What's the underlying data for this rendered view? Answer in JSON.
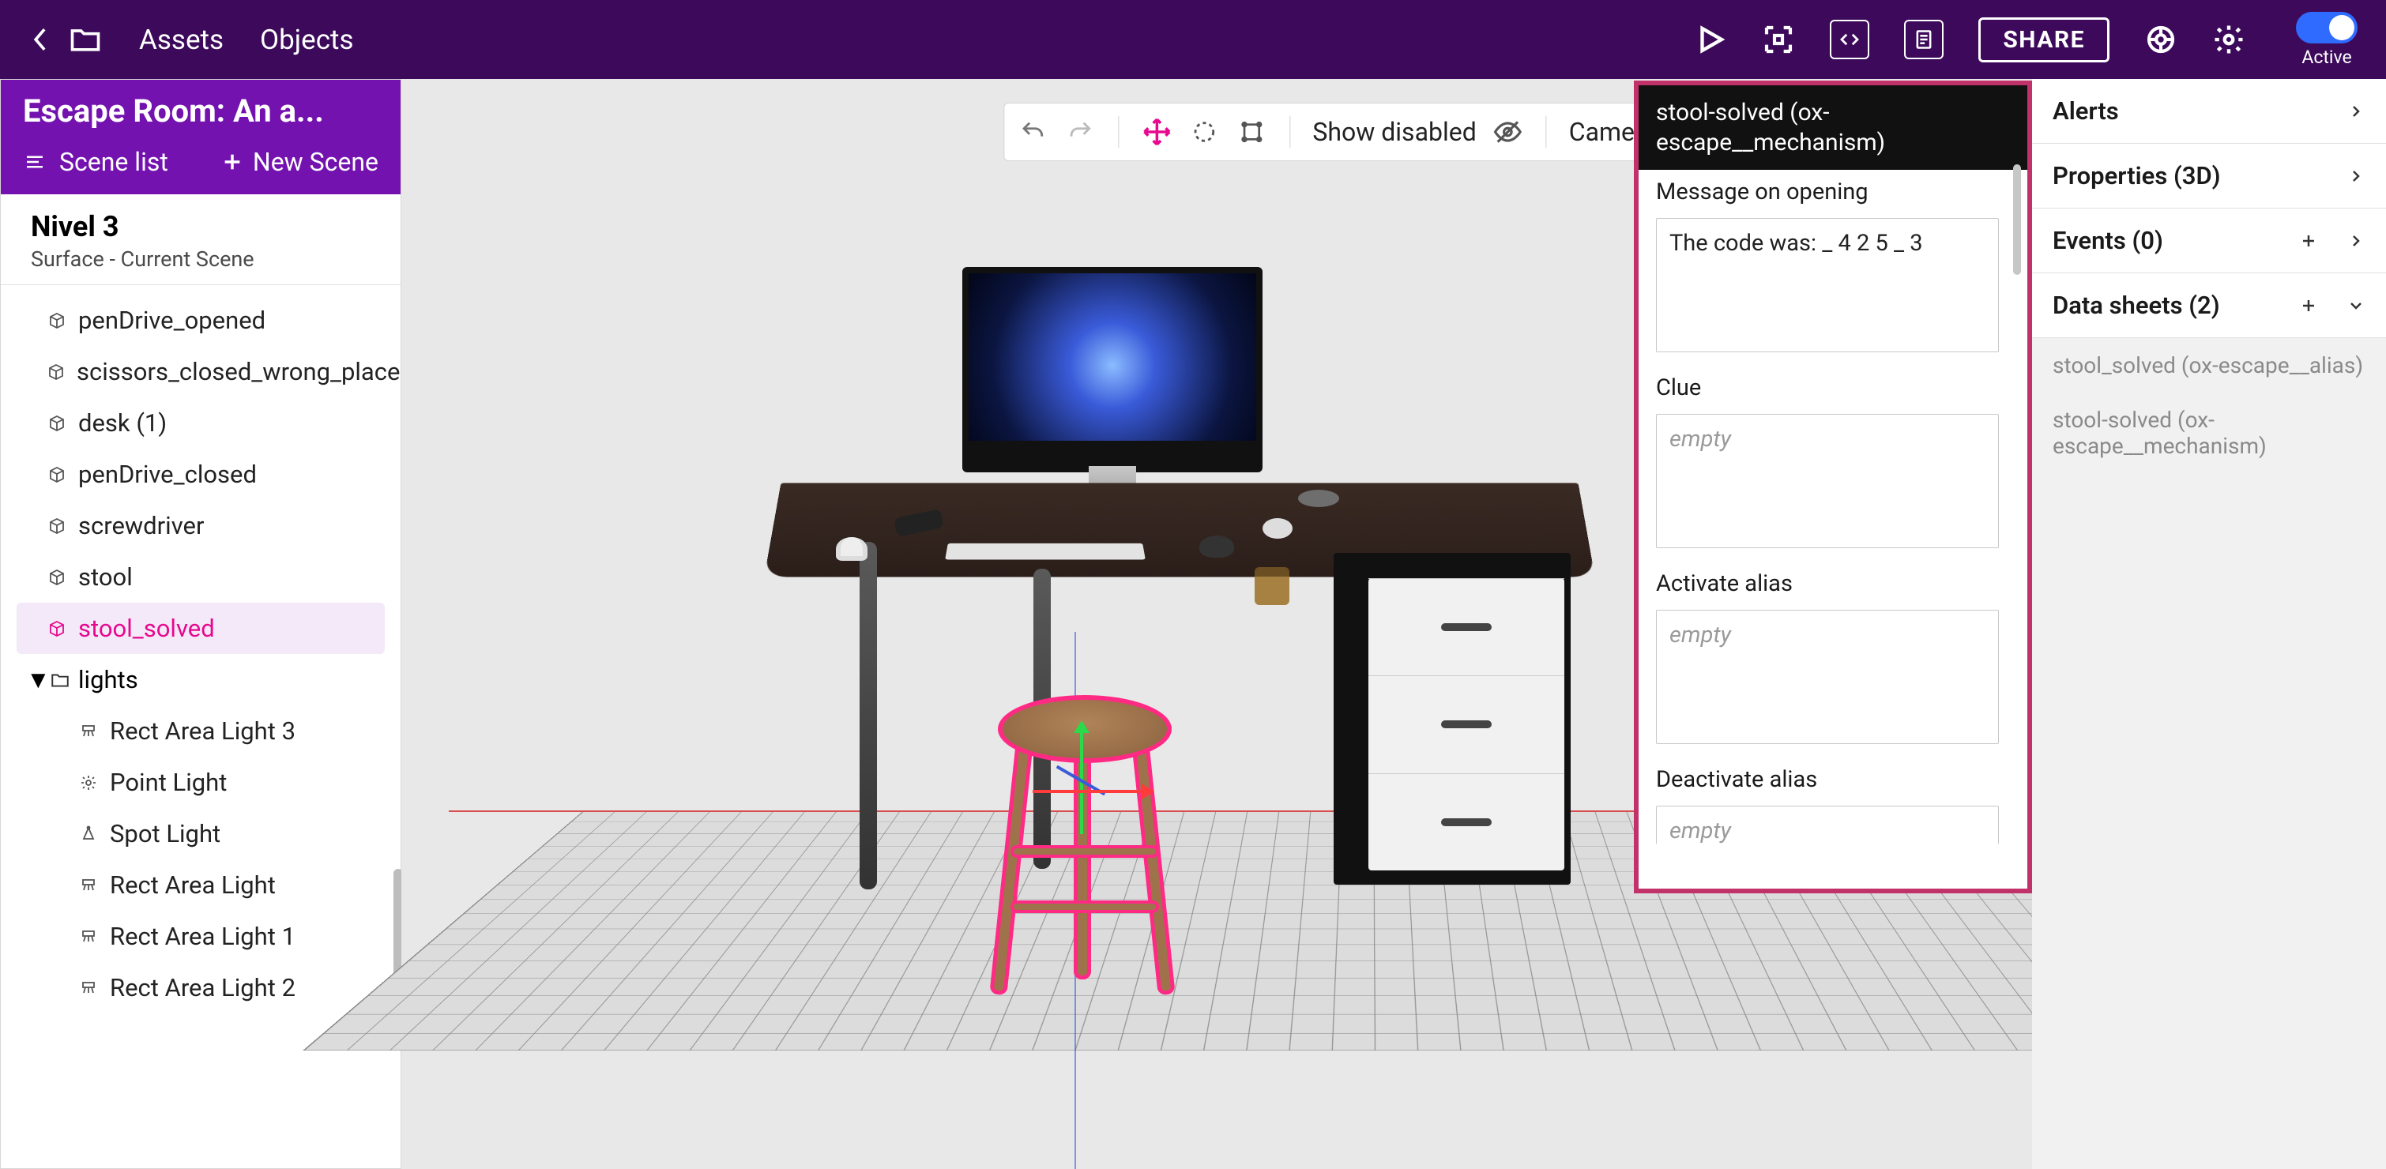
{
  "topbar": {
    "assets": "Assets",
    "objects": "Objects",
    "share": "SHARE",
    "active": "Active"
  },
  "project": {
    "title": "Escape Room: An a...",
    "scene_list": "Scene list",
    "new_scene": "New Scene"
  },
  "scene_header": {
    "name": "Nivel 3",
    "subtitle": "Surface - Current Scene"
  },
  "tree": {
    "items": [
      {
        "label": "penDrive_opened"
      },
      {
        "label": "scissors_closed_wrong_place..."
      },
      {
        "label": "desk (1)"
      },
      {
        "label": "penDrive_closed"
      },
      {
        "label": "screwdriver"
      },
      {
        "label": "stool"
      },
      {
        "label": "stool_solved",
        "selected": true
      }
    ],
    "folder": "lights",
    "lights": [
      "Rect Area Light 3",
      "Point Light",
      "Spot Light",
      "Rect Area Light",
      "Rect Area Light 1",
      "Rect Area Light 2"
    ]
  },
  "viewport_toolbar": {
    "show_disabled": "Show disabled",
    "camera": "Camera"
  },
  "sheet": {
    "title": "stool-solved (ox-escape__mechanism)",
    "fields": {
      "message_label": "Message on opening",
      "message_value": "The code was: _ 4 2 5 _ 3",
      "clue_label": "Clue",
      "clue_placeholder": "empty",
      "activate_label": "Activate alias",
      "activate_placeholder": "empty",
      "deactivate_label": "Deactivate alias",
      "deactivate_placeholder": "empty"
    }
  },
  "inspector": {
    "alerts": "Alerts",
    "properties": "Properties (3D)",
    "events": "Events (0)",
    "datasheets": "Data sheets (2)",
    "ds_items": [
      "stool_solved (ox-escape__alias)",
      "stool-solved (ox-escape__mechanism)"
    ]
  }
}
